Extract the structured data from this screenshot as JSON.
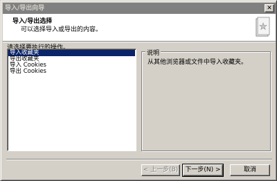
{
  "window": {
    "title": "导入/导出向导",
    "close_glyph": "✕"
  },
  "header": {
    "title": "导入/导出选择",
    "subtitle": "可以选择导入或导出的内容。",
    "icon": "wizard-book-icon"
  },
  "prompt": "请选择要执行的操作。",
  "actions": [
    {
      "label": "导入收藏夹",
      "selected": true
    },
    {
      "label": "导出收藏夹",
      "selected": false
    },
    {
      "label": "导入 Cookies",
      "selected": false
    },
    {
      "label": "导出 Cookies",
      "selected": false
    }
  ],
  "description": {
    "legend": "说明",
    "text": "从其他浏览器或文件中导入收藏夹。"
  },
  "buttons": {
    "back": "< 上一步(B)",
    "next": "下一步(N) >",
    "cancel": "取消"
  },
  "colors": {
    "selection": "#0a246a",
    "face": "#d4d0c8",
    "titlebar_inactive": "#808080"
  }
}
